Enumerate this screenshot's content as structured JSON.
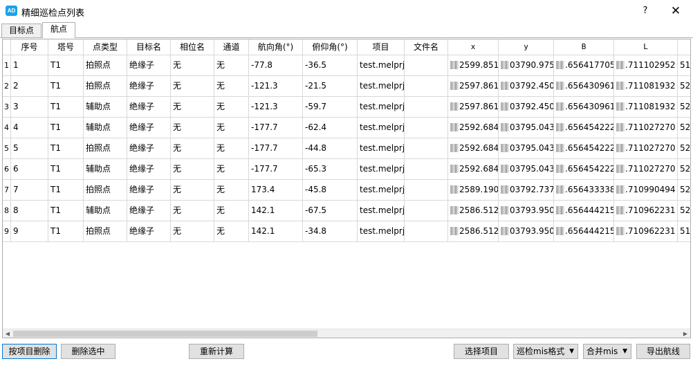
{
  "window": {
    "logo_text": "AD",
    "title": "精细巡检点列表",
    "help_label": "?",
    "close_label": "✕"
  },
  "tabs": [
    {
      "label": "目标点",
      "active": false
    },
    {
      "label": "航点",
      "active": true
    }
  ],
  "table": {
    "columns": [
      "序号",
      "塔号",
      "点类型",
      "目标名",
      "相位名",
      "通道",
      "航向角(°)",
      "俯仰角(°)",
      "项目",
      "文件名",
      "x",
      "y",
      "B",
      "L",
      ""
    ],
    "rows": [
      {
        "rownum": "1",
        "cells": [
          "1",
          "T1",
          "拍照点",
          "绝缘子",
          "无",
          "无",
          "-77.8",
          "-36.5",
          "test.melprj",
          "",
          "2599.851",
          "03790.975",
          ".656417705",
          ".711102952",
          "51"
        ]
      },
      {
        "rownum": "2",
        "cells": [
          "2",
          "T1",
          "拍照点",
          "绝缘子",
          "无",
          "无",
          "-121.3",
          "-21.5",
          "test.melprj",
          "",
          "2597.861",
          "03792.450",
          ".656430961",
          ".711081932",
          "52"
        ]
      },
      {
        "rownum": "3",
        "cells": [
          "3",
          "T1",
          "辅助点",
          "绝缘子",
          "无",
          "无",
          "-121.3",
          "-59.7",
          "test.melprj",
          "",
          "2597.861",
          "03792.450",
          ".656430961",
          ".711081932",
          "52"
        ]
      },
      {
        "rownum": "4",
        "cells": [
          "4",
          "T1",
          "辅助点",
          "绝缘子",
          "无",
          "无",
          "-177.7",
          "-62.4",
          "test.melprj",
          "",
          "2592.684",
          "03795.043",
          ".656454222",
          ".711027270",
          "52"
        ]
      },
      {
        "rownum": "5",
        "cells": [
          "5",
          "T1",
          "拍照点",
          "绝缘子",
          "无",
          "无",
          "-177.7",
          "-44.8",
          "test.melprj",
          "",
          "2592.684",
          "03795.043",
          ".656454222",
          ".711027270",
          "52"
        ]
      },
      {
        "rownum": "6",
        "cells": [
          "6",
          "T1",
          "辅助点",
          "绝缘子",
          "无",
          "无",
          "-177.7",
          "-65.3",
          "test.melprj",
          "",
          "2592.684",
          "03795.043",
          ".656454222",
          ".711027270",
          "52"
        ]
      },
      {
        "rownum": "7",
        "cells": [
          "7",
          "T1",
          "拍照点",
          "绝缘子",
          "无",
          "无",
          "173.4",
          "-45.8",
          "test.melprj",
          "",
          "2589.190",
          "03792.737",
          ".656433338",
          ".710990494",
          "52"
        ]
      },
      {
        "rownum": "8",
        "cells": [
          "8",
          "T1",
          "辅助点",
          "绝缘子",
          "无",
          "无",
          "142.1",
          "-67.5",
          "test.melprj",
          "",
          "2586.512",
          "03793.950",
          ".656444215",
          ".710962231",
          "52"
        ]
      },
      {
        "rownum": "9",
        "cells": [
          "9",
          "T1",
          "拍照点",
          "绝缘子",
          "无",
          "无",
          "142.1",
          "-34.8",
          "test.melprj",
          "",
          "2586.512",
          "03793.950",
          ".656444215",
          ".710962231",
          "51"
        ]
      }
    ]
  },
  "buttons": {
    "delete_by_project": "按项目删除",
    "delete_selected": "删除选中",
    "recalculate": "重新计算",
    "select_project": "选择项目",
    "export_route": "导出航线"
  },
  "combos": {
    "format": {
      "value": "巡检mis格式"
    },
    "merge": {
      "value": "合并mis"
    }
  }
}
